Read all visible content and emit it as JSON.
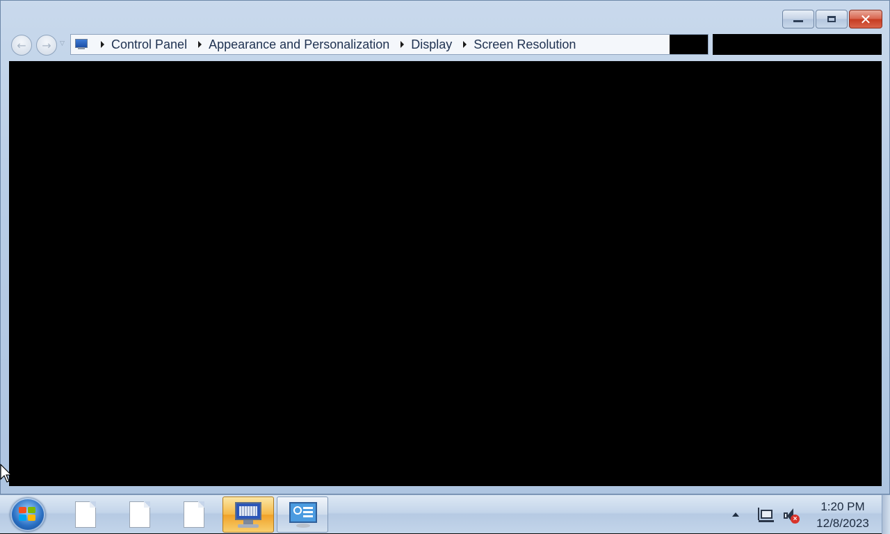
{
  "window": {
    "caption_buttons": {
      "minimize_icon": "minimize-icon",
      "maximize_icon": "restore-icon",
      "close_glyph": "✕"
    }
  },
  "navigation": {
    "back_icon": "back-arrow-icon",
    "forward_icon": "forward-arrow-icon",
    "back_glyph": "←",
    "forward_glyph": "→",
    "dropdown_glyph": "▽"
  },
  "address_bar": {
    "location_icon": "control-panel-icon",
    "breadcrumbs": [
      "Control Panel",
      "Appearance and Personalization",
      "Display",
      "Screen Resolution"
    ]
  },
  "taskbar": {
    "start_icon": "windows-start-orb-icon",
    "items": [
      {
        "icon": "document-icon",
        "state": "normal"
      },
      {
        "icon": "document-icon",
        "state": "normal"
      },
      {
        "icon": "document-icon",
        "state": "normal"
      },
      {
        "icon": "on-screen-keyboard-icon",
        "state": "active"
      },
      {
        "icon": "control-panel-icon",
        "state": "open"
      }
    ],
    "tray": {
      "icons": [
        "show-hidden-icons-arrow",
        "network-icon",
        "volume-muted-icon"
      ],
      "mute_glyph": "×"
    },
    "clock": {
      "time": "1:20 PM",
      "date": "12/8/2023"
    }
  },
  "colors": {
    "accent_active": "#f5b847",
    "close_button": "#c53b21",
    "content_background": "#000000"
  }
}
